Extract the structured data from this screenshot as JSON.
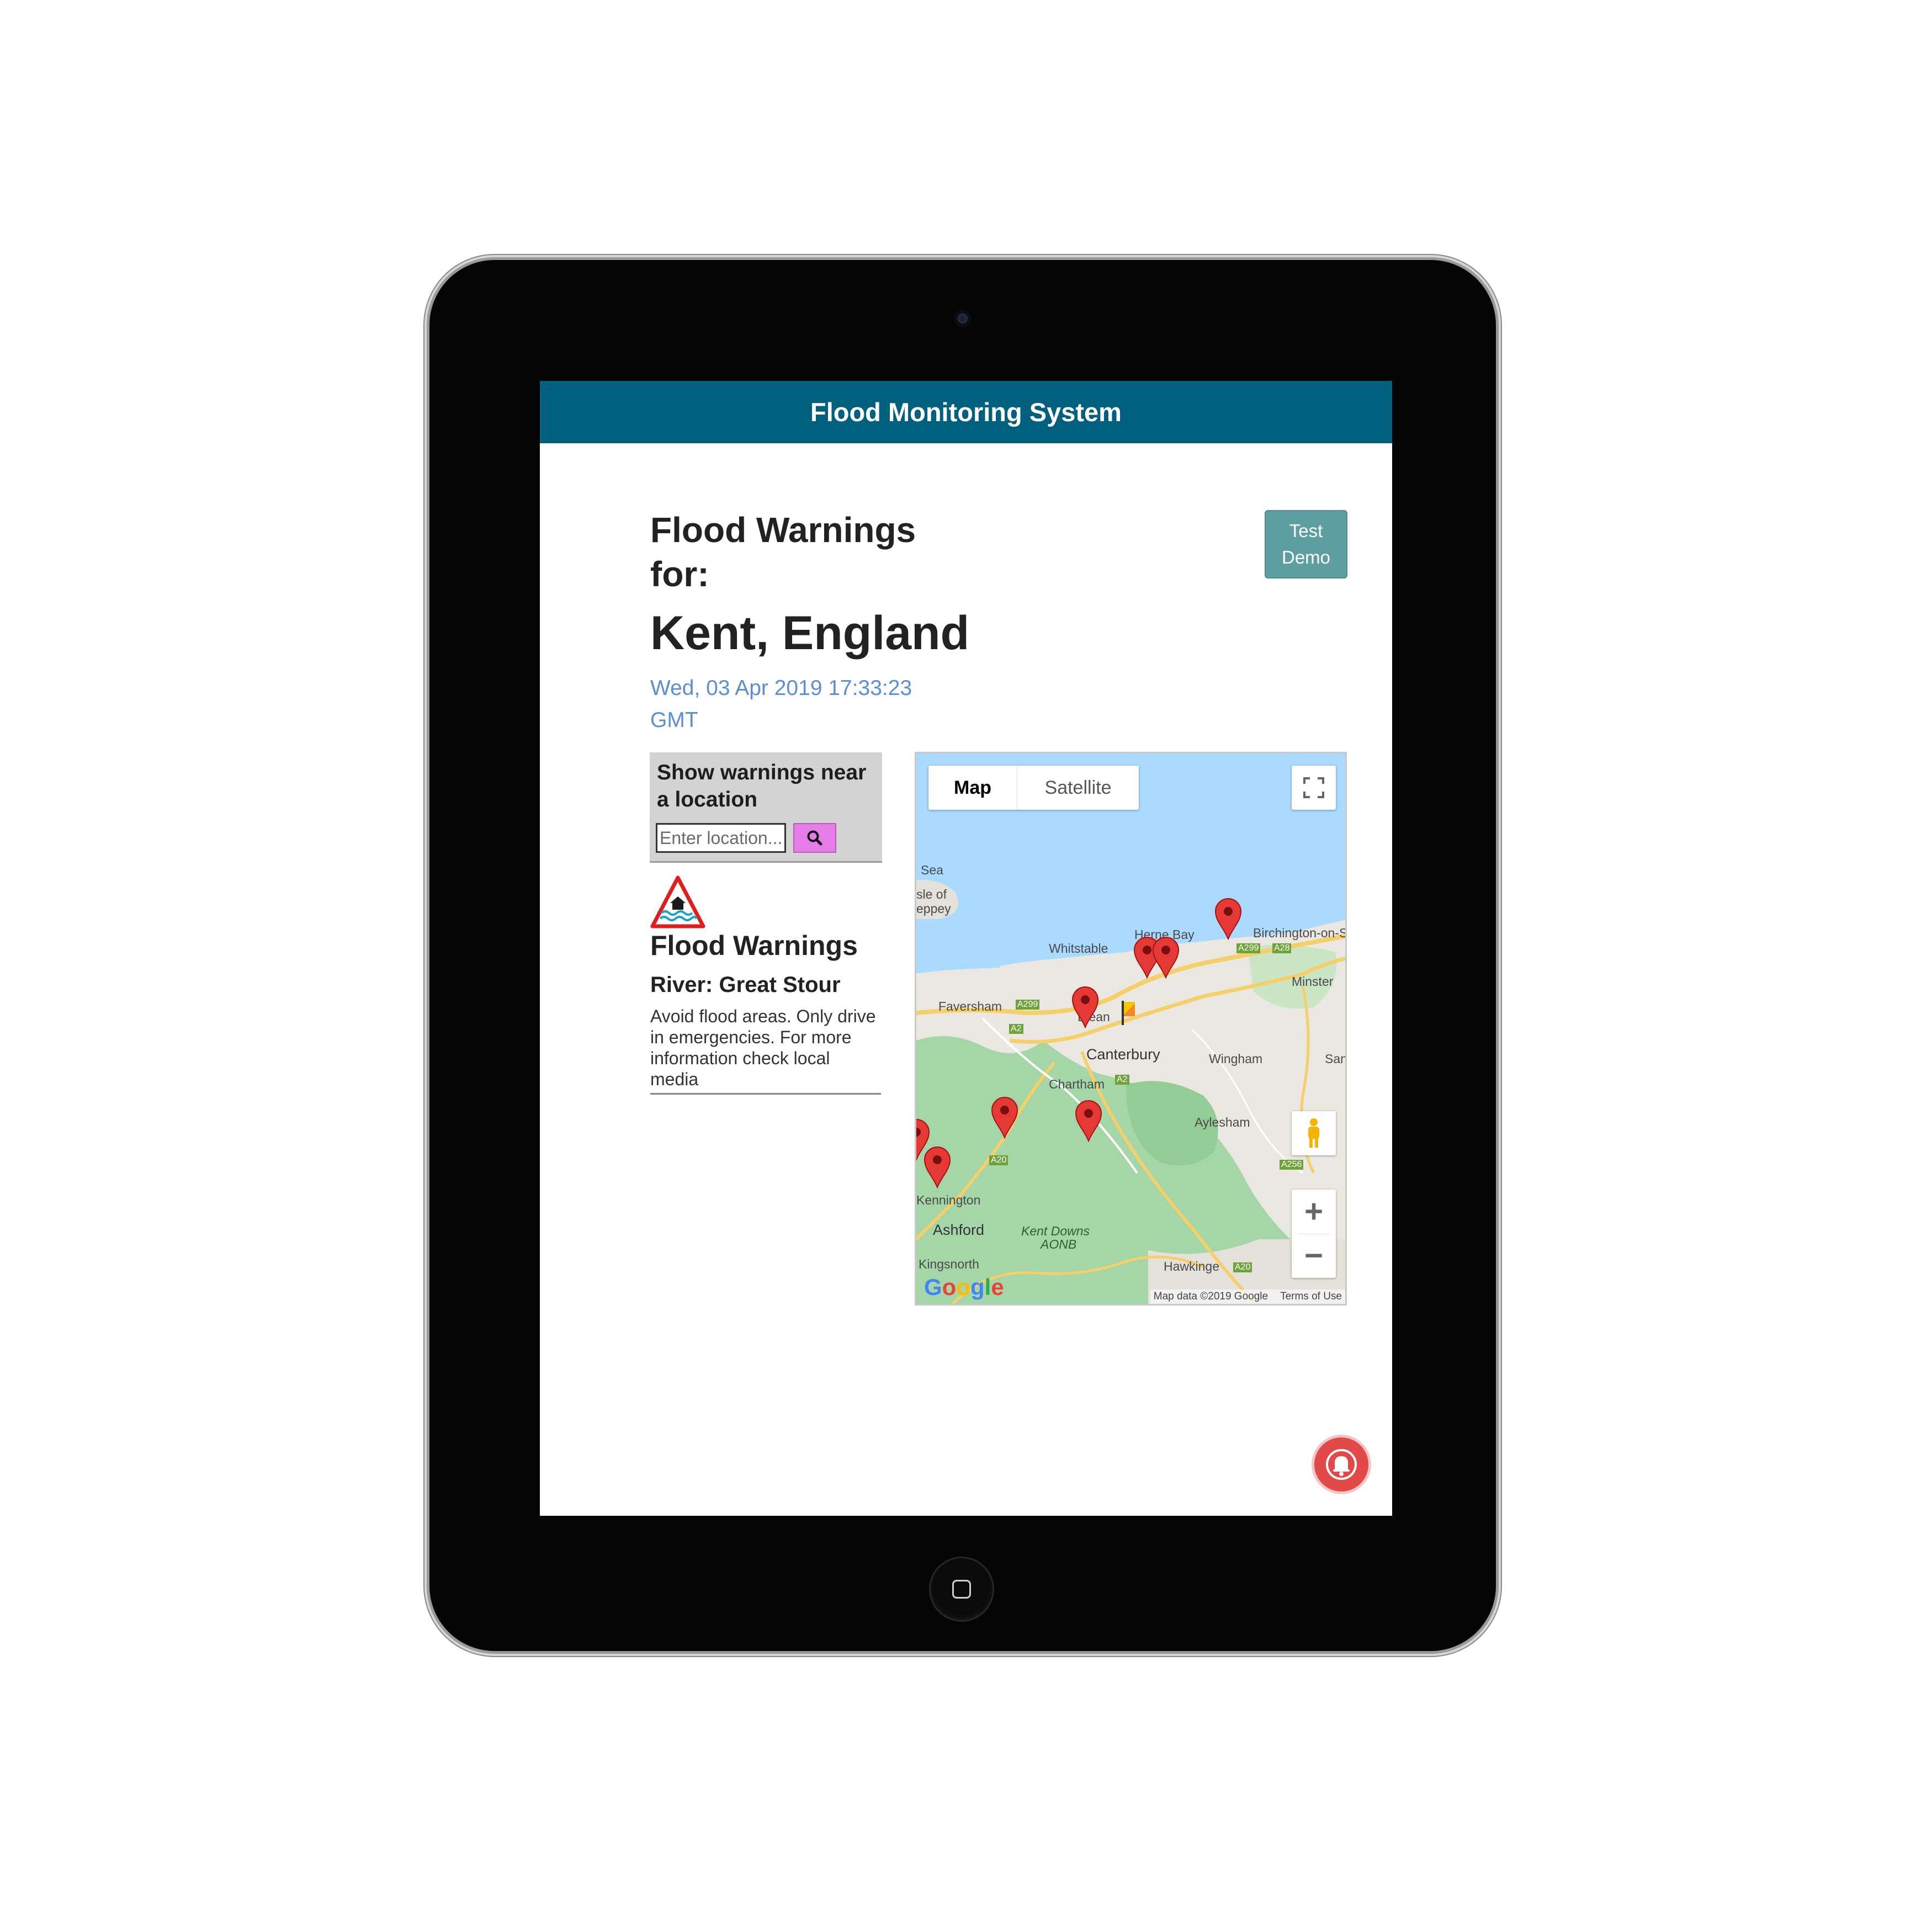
{
  "app": {
    "title": "Flood Monitoring System"
  },
  "header": {
    "warnings_for": "Flood Warnings for:",
    "region": "Kent, England",
    "datetime": "Wed, 03 Apr 2019 17:33:23 GMT"
  },
  "demo_button": {
    "label": "Test Demo"
  },
  "search": {
    "title": "Show warnings near a location",
    "placeholder": "Enter location...",
    "icon": "search-icon"
  },
  "warning": {
    "icon": "flood-warning-icon",
    "heading": "Flood Warnings",
    "river": "River: Great Stour",
    "advice": "Avoid flood areas. Only drive in emergencies. For more information check local media"
  },
  "map": {
    "type_buttons": [
      {
        "label": "Map"
      },
      {
        "label": "Satellite"
      }
    ],
    "selected_type": "Map",
    "labels": {
      "sea": "Sea",
      "isle1": "sle of",
      "isle2": "eppey",
      "whitstable": "Whitstable",
      "herne_bay": "Herne Bay",
      "birchington": "Birchington-on-S",
      "faversham": "Faversham",
      "blean": "Blean",
      "canterbury": "Canterbury",
      "minster": "Minster",
      "wingham": "Wingham",
      "sandwich": "Sandwi",
      "chartham": "Chartham",
      "aylesham": "Aylesham",
      "kennington": "Kennington",
      "ashford": "Ashford",
      "kent_downs1": "Kent Downs",
      "kent_downs2": "AONB",
      "kingsnorth": "Kingsnorth",
      "hawkinge": "Hawkinge"
    },
    "roads": {
      "a299_1": "A299",
      "a299_2": "A299",
      "a28": "A28",
      "a2_1": "A2",
      "a2_2": "A2",
      "a20_1": "A20",
      "a20_2": "A20",
      "a256": "A256"
    },
    "logo": "Google",
    "map_data": "Map data ©2019 Google",
    "terms": "Terms of Use",
    "zoom_in": "+",
    "zoom_out": "−",
    "marker_color": "#e53935"
  },
  "alert_button": {
    "icon": "bell-icon"
  },
  "colors": {
    "topbar": "#00607e",
    "demo_button": "#5d9ea0",
    "search_button": "#e67ce8",
    "datetime": "#5a8fd8",
    "alert_button": "#e24a4a"
  }
}
